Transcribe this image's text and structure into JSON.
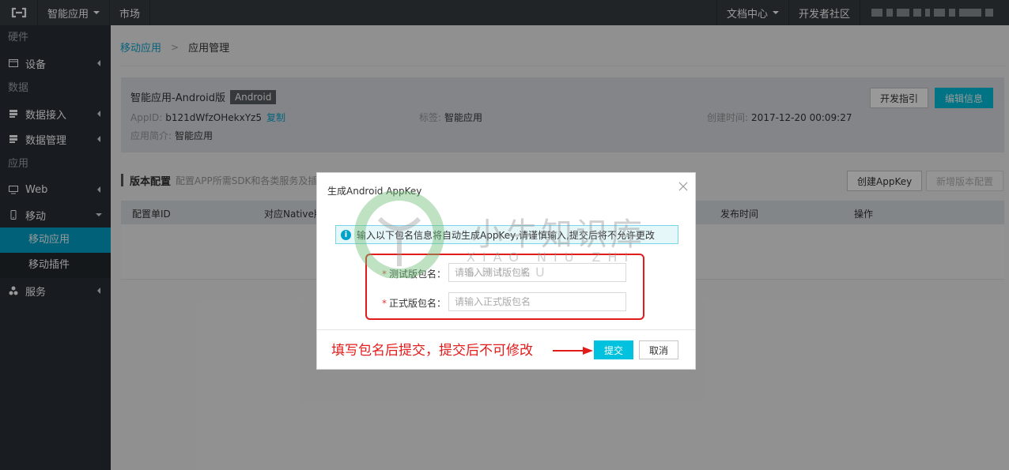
{
  "topbar": {
    "product_menu": "智能应用",
    "market": "市场",
    "docs": "文档中心",
    "community": "开发者社区"
  },
  "sidebar": {
    "sections": [
      {
        "title": "硬件",
        "items": [
          {
            "label": "设备",
            "icon": "device-icon"
          }
        ]
      },
      {
        "title": "数据",
        "items": [
          {
            "label": "数据接入",
            "icon": "data-access-icon"
          },
          {
            "label": "数据管理",
            "icon": "data-manage-icon"
          }
        ]
      },
      {
        "title": "应用",
        "items": [
          {
            "label": "Web",
            "icon": "monitor-icon"
          },
          {
            "label": "移动",
            "icon": "mobile-icon"
          }
        ]
      }
    ],
    "mobile_sub": [
      "移动应用",
      "移动插件"
    ],
    "service": "服务"
  },
  "breadcrumb": {
    "parent": "移动应用",
    "current": "应用管理"
  },
  "app": {
    "name": "智能应用-Android版",
    "platform_badge": "Android",
    "appid_label": "AppID:",
    "appid_value": "b121dWfzOHekxYz5",
    "copy_label": "复制",
    "tag_label": "标签:",
    "tag_value": "智能应用",
    "created_label": "创建时间:",
    "created_value": "2017-12-20 00:09:27",
    "intro_label": "应用简介:",
    "intro_value": "智能应用",
    "guide_button": "开发指引",
    "edit_button": "编辑信息"
  },
  "version_config": {
    "title": "版本配置",
    "description": "配置APP所需SDK和各类服务及插件",
    "create_appkey_button": "创建AppKey",
    "add_version_button": "新增版本配置",
    "columns": [
      "配置单ID",
      "对应Native版",
      "发布时间",
      "操作"
    ]
  },
  "modal": {
    "title": "生成Android AppKey",
    "info": "输入以下包名信息将自动生成AppKey,请谨慎输入,提交后将不允许更改",
    "test_label": "测试版包名：",
    "test_placeholder": "请输入测试版包名",
    "release_label": "正式版包名：",
    "release_placeholder": "请输入正式版包名",
    "submit": "提交",
    "cancel": "取消",
    "annotation": "填写包名后提交，提交后不可修改"
  },
  "watermark": {
    "text": "小牛知识库",
    "sub": "XIAO NIU ZHI SHI KU"
  }
}
